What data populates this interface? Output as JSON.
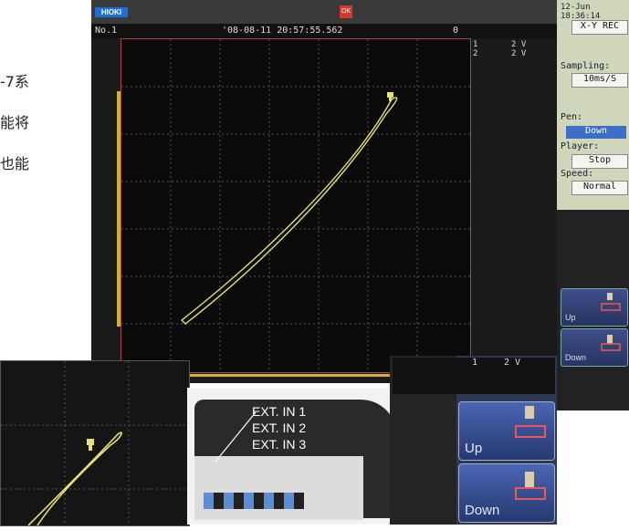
{
  "left_text": [
    "-7系",
    "能将",
    "也能"
  ],
  "topbar": {
    "brand": "HIOKI",
    "ok_label": "OK"
  },
  "header": {
    "channel": "No.1",
    "trigger_time": "'08-08-11 20:57:55.562",
    "count": "0",
    "ch_labels": "1\n2",
    "ch_scale": "2 V\n2 V"
  },
  "side": {
    "datetime": "12-Jun 18:36:14",
    "mode": "X-Y REC",
    "sampling_label": "Sampling:",
    "sampling_value": "10ms/S",
    "pen_label": "Pen:",
    "pen_value": "Down",
    "player_label": "Player:",
    "player_value": "Stop",
    "speed_label": "Speed:",
    "speed_value": "Normal",
    "up_label": "Up",
    "down_label": "Down"
  },
  "inset_device": {
    "ext_lines": [
      "EXT. IN 1",
      "EXT. IN 2",
      "EXT. IN 3"
    ]
  },
  "inset_buttons": {
    "ch_label": "1",
    "scale": "2 V",
    "up_label": "Up",
    "down_label": "Down"
  },
  "colors": {
    "trace": "#e6e07a",
    "plot_border": "#aa4444",
    "button": "#3d4f8a"
  }
}
